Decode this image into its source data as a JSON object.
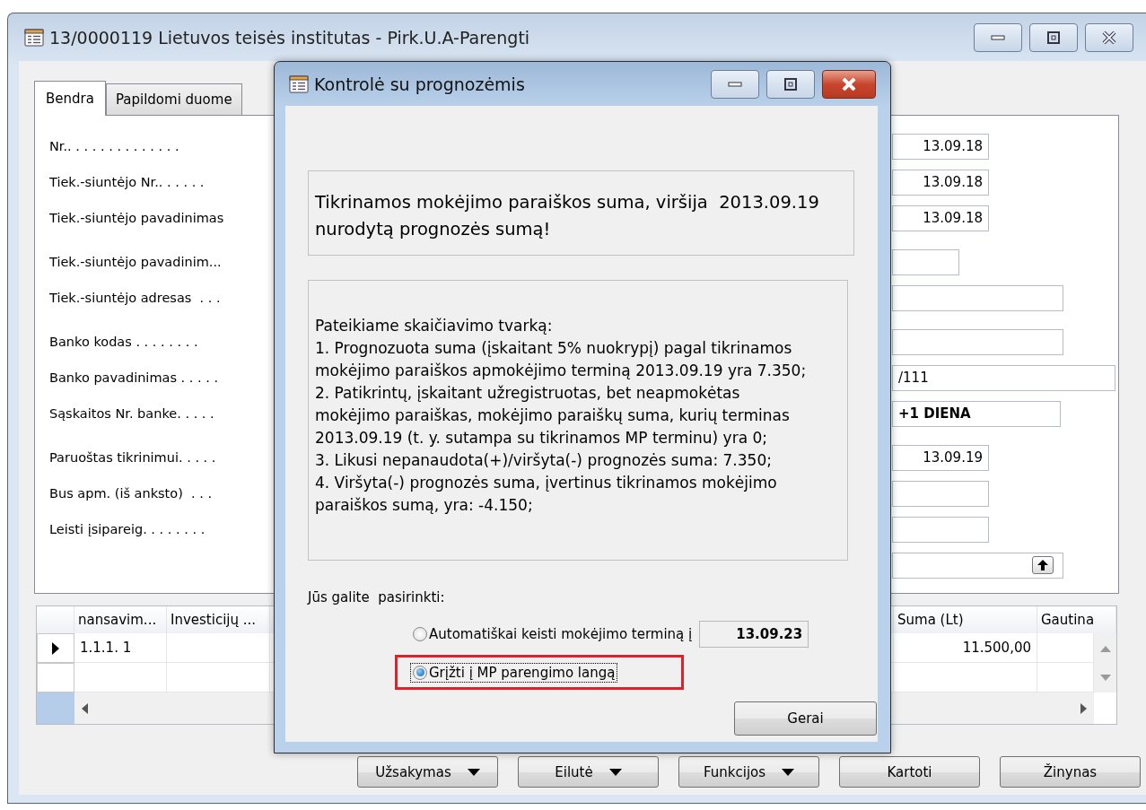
{
  "main_window": {
    "title": "13/0000119 Lietuvos teisės institutas - Pirk.U.A-Parengti"
  },
  "tabs": [
    {
      "label": "Bendra",
      "selected": true
    },
    {
      "label": "Papildomi duome",
      "selected": false
    }
  ],
  "fields": [
    {
      "label": "Nr.. . . . . . . . . . . . . .",
      "kind": "date",
      "value": "13.09.18"
    },
    {
      "label": "Tiek.-siuntėjo Nr.. . . . . .",
      "kind": "date",
      "value": "13.09.18"
    },
    {
      "label": "Tiek.-siuntėjo pavadinimas",
      "kind": "date",
      "value": "13.09.18"
    },
    {
      "label": "Tiek.-siuntėjo pavadinim...",
      "kind": "text"
    },
    {
      "label": "Tiek.-siuntėjo adresas  . . .",
      "kind": "text"
    },
    {
      "label": "Banko kodas . . . . . . . .",
      "kind": "text"
    },
    {
      "label": "Banko pavadinimas . . . . .",
      "kind": "text",
      "value": "/111"
    },
    {
      "label": "Sąskaitos Nr. banke. . . . .",
      "kind": "bold",
      "value": "+1 DIENA"
    },
    {
      "label": "Paruoštas tikrinimui. . . . .",
      "kind": "date",
      "value": "13.09.19"
    },
    {
      "label": "Bus apm. (iš anksto)  . . .",
      "kind": "text"
    },
    {
      "label": "Leisti įsipareig. . . . . . . .",
      "kind": "text"
    },
    {
      "kind": "picker"
    }
  ],
  "lines_grid": {
    "columns": [
      "nansavim...",
      "Investicijų ...",
      "Suma (Lt)",
      "Gautina"
    ],
    "rows": [
      {
        "selected": true,
        "column_1": "1.1.1. 1",
        "suma": "11.500,00"
      },
      {
        "selected": false
      }
    ]
  },
  "buttons": [
    {
      "label": "Užsakymas",
      "kind": "menu"
    },
    {
      "label": "Eilutė",
      "kind": "menu"
    },
    {
      "label": "Funkcijos",
      "kind": "menu"
    },
    {
      "label": "Kartoti",
      "kind": "plain"
    },
    {
      "label": "Žinynas",
      "kind": "plain"
    }
  ],
  "dialog": {
    "title": "Kontrolė su prognozėmis",
    "warning": "Tikrinamos mokėjimo paraiškos suma, viršija  2013.09.19 nurodytą prognozės sumą!",
    "details": "Pateikiame skaičiavimo tvarką:\n1. Prognozuota suma (įskaitant 5% nuokrypį) pagal tikrinamos\nmokėjimo paraiškos apmokėjimo terminą 2013.09.19 yra 7.350;\n2. Patikrintų, įskaitant užregistruotas, bet neapmokėtas\nmokėjimo paraiškas, mokėjimo paraiškų suma, kurių terminas\n2013.09.19 (t. y. sutampa su tikrinamos MP terminu) yra 0;\n3. Likusi nepanaudota(+)/viršyta(-) prognozės suma: 7.350;\n4. Viršyta(-) prognozės suma, įvertinus tikrinamos mokėjimo\nparaiškos sumą, yra: -4.150;",
    "prompt": "Jūs galite  pasirinkti:",
    "choices": [
      {
        "label": "Automatiškai keisti mokėjimo terminą į",
        "selected": false,
        "focused": false,
        "highlighted": false,
        "date": "13.09.23"
      },
      {
        "label": "Grįžti į MP parengimo langą",
        "selected": true,
        "focused": true,
        "highlighted": true
      }
    ],
    "ok_button": "Gerai"
  }
}
